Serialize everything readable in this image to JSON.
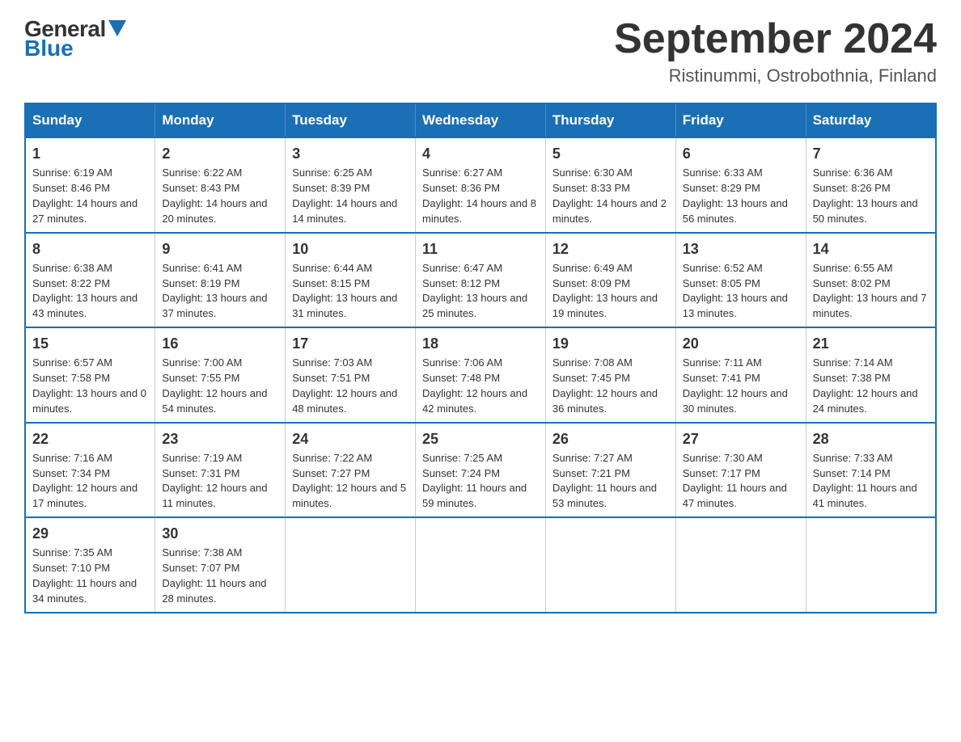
{
  "logo": {
    "general": "General",
    "blue": "Blue"
  },
  "header": {
    "month": "September 2024",
    "location": "Ristinummi, Ostrobothnia, Finland"
  },
  "weekdays": [
    "Sunday",
    "Monday",
    "Tuesday",
    "Wednesday",
    "Thursday",
    "Friday",
    "Saturday"
  ],
  "weeks": [
    [
      {
        "day": 1,
        "sunrise": "Sunrise: 6:19 AM",
        "sunset": "Sunset: 8:46 PM",
        "daylight": "Daylight: 14 hours and 27 minutes."
      },
      {
        "day": 2,
        "sunrise": "Sunrise: 6:22 AM",
        "sunset": "Sunset: 8:43 PM",
        "daylight": "Daylight: 14 hours and 20 minutes."
      },
      {
        "day": 3,
        "sunrise": "Sunrise: 6:25 AM",
        "sunset": "Sunset: 8:39 PM",
        "daylight": "Daylight: 14 hours and 14 minutes."
      },
      {
        "day": 4,
        "sunrise": "Sunrise: 6:27 AM",
        "sunset": "Sunset: 8:36 PM",
        "daylight": "Daylight: 14 hours and 8 minutes."
      },
      {
        "day": 5,
        "sunrise": "Sunrise: 6:30 AM",
        "sunset": "Sunset: 8:33 PM",
        "daylight": "Daylight: 14 hours and 2 minutes."
      },
      {
        "day": 6,
        "sunrise": "Sunrise: 6:33 AM",
        "sunset": "Sunset: 8:29 PM",
        "daylight": "Daylight: 13 hours and 56 minutes."
      },
      {
        "day": 7,
        "sunrise": "Sunrise: 6:36 AM",
        "sunset": "Sunset: 8:26 PM",
        "daylight": "Daylight: 13 hours and 50 minutes."
      }
    ],
    [
      {
        "day": 8,
        "sunrise": "Sunrise: 6:38 AM",
        "sunset": "Sunset: 8:22 PM",
        "daylight": "Daylight: 13 hours and 43 minutes."
      },
      {
        "day": 9,
        "sunrise": "Sunrise: 6:41 AM",
        "sunset": "Sunset: 8:19 PM",
        "daylight": "Daylight: 13 hours and 37 minutes."
      },
      {
        "day": 10,
        "sunrise": "Sunrise: 6:44 AM",
        "sunset": "Sunset: 8:15 PM",
        "daylight": "Daylight: 13 hours and 31 minutes."
      },
      {
        "day": 11,
        "sunrise": "Sunrise: 6:47 AM",
        "sunset": "Sunset: 8:12 PM",
        "daylight": "Daylight: 13 hours and 25 minutes."
      },
      {
        "day": 12,
        "sunrise": "Sunrise: 6:49 AM",
        "sunset": "Sunset: 8:09 PM",
        "daylight": "Daylight: 13 hours and 19 minutes."
      },
      {
        "day": 13,
        "sunrise": "Sunrise: 6:52 AM",
        "sunset": "Sunset: 8:05 PM",
        "daylight": "Daylight: 13 hours and 13 minutes."
      },
      {
        "day": 14,
        "sunrise": "Sunrise: 6:55 AM",
        "sunset": "Sunset: 8:02 PM",
        "daylight": "Daylight: 13 hours and 7 minutes."
      }
    ],
    [
      {
        "day": 15,
        "sunrise": "Sunrise: 6:57 AM",
        "sunset": "Sunset: 7:58 PM",
        "daylight": "Daylight: 13 hours and 0 minutes."
      },
      {
        "day": 16,
        "sunrise": "Sunrise: 7:00 AM",
        "sunset": "Sunset: 7:55 PM",
        "daylight": "Daylight: 12 hours and 54 minutes."
      },
      {
        "day": 17,
        "sunrise": "Sunrise: 7:03 AM",
        "sunset": "Sunset: 7:51 PM",
        "daylight": "Daylight: 12 hours and 48 minutes."
      },
      {
        "day": 18,
        "sunrise": "Sunrise: 7:06 AM",
        "sunset": "Sunset: 7:48 PM",
        "daylight": "Daylight: 12 hours and 42 minutes."
      },
      {
        "day": 19,
        "sunrise": "Sunrise: 7:08 AM",
        "sunset": "Sunset: 7:45 PM",
        "daylight": "Daylight: 12 hours and 36 minutes."
      },
      {
        "day": 20,
        "sunrise": "Sunrise: 7:11 AM",
        "sunset": "Sunset: 7:41 PM",
        "daylight": "Daylight: 12 hours and 30 minutes."
      },
      {
        "day": 21,
        "sunrise": "Sunrise: 7:14 AM",
        "sunset": "Sunset: 7:38 PM",
        "daylight": "Daylight: 12 hours and 24 minutes."
      }
    ],
    [
      {
        "day": 22,
        "sunrise": "Sunrise: 7:16 AM",
        "sunset": "Sunset: 7:34 PM",
        "daylight": "Daylight: 12 hours and 17 minutes."
      },
      {
        "day": 23,
        "sunrise": "Sunrise: 7:19 AM",
        "sunset": "Sunset: 7:31 PM",
        "daylight": "Daylight: 12 hours and 11 minutes."
      },
      {
        "day": 24,
        "sunrise": "Sunrise: 7:22 AM",
        "sunset": "Sunset: 7:27 PM",
        "daylight": "Daylight: 12 hours and 5 minutes."
      },
      {
        "day": 25,
        "sunrise": "Sunrise: 7:25 AM",
        "sunset": "Sunset: 7:24 PM",
        "daylight": "Daylight: 11 hours and 59 minutes."
      },
      {
        "day": 26,
        "sunrise": "Sunrise: 7:27 AM",
        "sunset": "Sunset: 7:21 PM",
        "daylight": "Daylight: 11 hours and 53 minutes."
      },
      {
        "day": 27,
        "sunrise": "Sunrise: 7:30 AM",
        "sunset": "Sunset: 7:17 PM",
        "daylight": "Daylight: 11 hours and 47 minutes."
      },
      {
        "day": 28,
        "sunrise": "Sunrise: 7:33 AM",
        "sunset": "Sunset: 7:14 PM",
        "daylight": "Daylight: 11 hours and 41 minutes."
      }
    ],
    [
      {
        "day": 29,
        "sunrise": "Sunrise: 7:35 AM",
        "sunset": "Sunset: 7:10 PM",
        "daylight": "Daylight: 11 hours and 34 minutes."
      },
      {
        "day": 30,
        "sunrise": "Sunrise: 7:38 AM",
        "sunset": "Sunset: 7:07 PM",
        "daylight": "Daylight: 11 hours and 28 minutes."
      },
      null,
      null,
      null,
      null,
      null
    ]
  ]
}
